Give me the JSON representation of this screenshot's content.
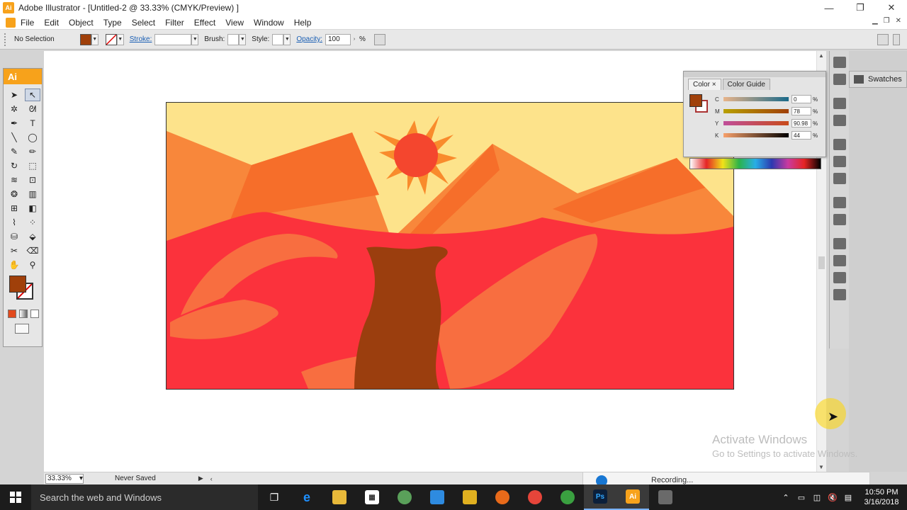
{
  "window": {
    "title": "Adobe Illustrator - [Untitled-2 @ 33.33% (CMYK/Preview) ]",
    "app_icon": "Ai",
    "minimize": "—",
    "restore": "❐",
    "close": "✕"
  },
  "menu": {
    "items": [
      "File",
      "Edit",
      "Object",
      "Type",
      "Select",
      "Filter",
      "Effect",
      "View",
      "Window",
      "Help"
    ]
  },
  "control_bar": {
    "selection": "No Selection",
    "stroke_label": "Stroke:",
    "brush_label": "Brush:",
    "style_label": "Style:",
    "opacity_label": "Opacity:",
    "opacity_value": "100",
    "percent": "%"
  },
  "tools": {
    "header": "Ai",
    "fill_color": "#a0400a",
    "items": [
      {
        "name": "selection-tool-icon",
        "glyph": "➤",
        "active": false
      },
      {
        "name": "direct-selection-tool-icon",
        "glyph": "↖",
        "active": true
      },
      {
        "name": "magic-wand-tool-icon",
        "glyph": "✲",
        "active": false
      },
      {
        "name": "lasso-tool-icon",
        "glyph": "ᘛ",
        "active": false
      },
      {
        "name": "pen-tool-icon",
        "glyph": "✒",
        "active": false
      },
      {
        "name": "type-tool-icon",
        "glyph": "T",
        "active": false
      },
      {
        "name": "line-tool-icon",
        "glyph": "╲",
        "active": false
      },
      {
        "name": "ellipse-tool-icon",
        "glyph": "◯",
        "active": false
      },
      {
        "name": "paintbrush-tool-icon",
        "glyph": "✎",
        "active": false
      },
      {
        "name": "pencil-tool-icon",
        "glyph": "✏",
        "active": false
      },
      {
        "name": "rotate-tool-icon",
        "glyph": "↻",
        "active": false
      },
      {
        "name": "scale-tool-icon",
        "glyph": "⬚",
        "active": false
      },
      {
        "name": "warp-tool-icon",
        "glyph": "≋",
        "active": false
      },
      {
        "name": "free-transform-tool-icon",
        "glyph": "⊡",
        "active": false
      },
      {
        "name": "symbol-sprayer-tool-icon",
        "glyph": "❂",
        "active": false
      },
      {
        "name": "column-graph-tool-icon",
        "glyph": "▥",
        "active": false
      },
      {
        "name": "mesh-tool-icon",
        "glyph": "⊞",
        "active": false
      },
      {
        "name": "gradient-tool-icon",
        "glyph": "◧",
        "active": false
      },
      {
        "name": "eyedropper-tool-icon",
        "glyph": "⌇",
        "active": false
      },
      {
        "name": "blend-tool-icon",
        "glyph": "⁘",
        "active": false
      },
      {
        "name": "live-paint-bucket-tool-icon",
        "glyph": "⛁",
        "active": false
      },
      {
        "name": "live-paint-selection-tool-icon",
        "glyph": "⬙",
        "active": false
      },
      {
        "name": "slice-tool-icon",
        "glyph": "✂",
        "active": false
      },
      {
        "name": "eraser-tool-icon",
        "glyph": "⌫",
        "active": false
      },
      {
        "name": "hand-tool-icon",
        "glyph": "✋",
        "active": false
      },
      {
        "name": "zoom-tool-icon",
        "glyph": "⚲",
        "active": false
      }
    ]
  },
  "color_panel": {
    "tab_color": "Color",
    "tab_guide": "Color Guide",
    "fill_color": "#a0400a",
    "sliders": [
      {
        "letter": "C",
        "value": "0",
        "gradient": "linear-gradient(90deg,#e8b48a,#1a6a8a)"
      },
      {
        "letter": "M",
        "value": "78",
        "gradient": "linear-gradient(90deg,#b8a000,#a0400a)"
      },
      {
        "letter": "Y",
        "value": "90.98",
        "gradient": "linear-gradient(90deg,#c04e9a,#c84b1a)"
      },
      {
        "letter": "K",
        "value": "44",
        "gradient": "linear-gradient(90deg,#f7a06a,#000000)"
      }
    ],
    "percent": "%"
  },
  "dock": {
    "swatches": "Swatches"
  },
  "status": {
    "zoom": "33.33%",
    "save_state": "Never Saved"
  },
  "watermark": {
    "line1": "Activate Windows",
    "line2": "Go to Settings to activate Windows."
  },
  "recording": {
    "text": "Recording..."
  },
  "taskbar": {
    "search_placeholder": "Search the web and Windows",
    "time": "10:50 PM",
    "date": "3/16/2018"
  }
}
